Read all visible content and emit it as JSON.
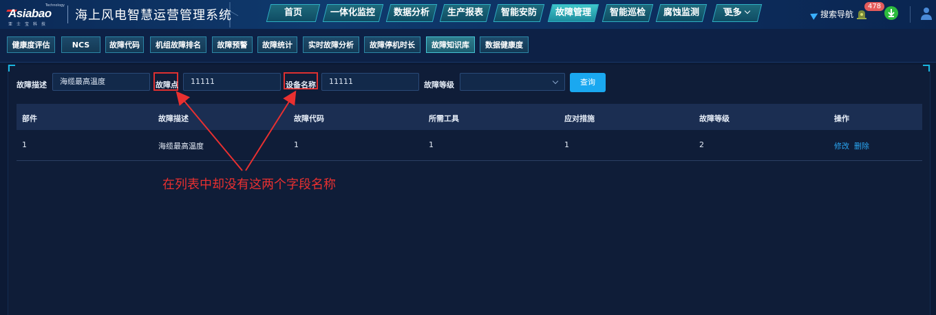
{
  "header": {
    "logo_text": "Asiabao",
    "logo_sub": "亚士宝科技",
    "logo_tech": "Technology",
    "system_title": "海上风电智慧运营管理系统",
    "nav": [
      {
        "label": "首页"
      },
      {
        "label": "一体化监控"
      },
      {
        "label": "数据分析"
      },
      {
        "label": "生产报表"
      },
      {
        "label": "智能安防"
      },
      {
        "label": "故障管理",
        "active": true
      },
      {
        "label": "智能巡检"
      },
      {
        "label": "腐蚀监测"
      },
      {
        "label": "更多"
      }
    ],
    "search_nav_label": "搜索导航",
    "notification_count": "478"
  },
  "subtabs": [
    {
      "label": "健康度评估"
    },
    {
      "label": "NCS"
    },
    {
      "label": "故障代码"
    },
    {
      "label": "机组故障排名"
    },
    {
      "label": "故障预警"
    },
    {
      "label": "故障统计"
    },
    {
      "label": "实时故障分析"
    },
    {
      "label": "故障停机时长"
    },
    {
      "label": "故障知识库",
      "active": true
    },
    {
      "label": "数据健康度"
    }
  ],
  "filters": {
    "fault_desc_label": "故障描述",
    "fault_desc_value": "海缆最高温度",
    "fault_point_label": "故障点",
    "fault_point_value": "11111",
    "device_name_label": "设备名称",
    "device_name_value": "11111",
    "fault_level_label": "故障等级",
    "fault_level_value": "",
    "query_label": "查询"
  },
  "table": {
    "columns": [
      "部件",
      "故障描述",
      "故障代码",
      "所需工具",
      "应对措施",
      "故障等级",
      "操作"
    ],
    "rows": [
      {
        "part": "1",
        "desc": "海缆最高温度",
        "code": "1",
        "tools": "1",
        "measures": "1",
        "level": "2",
        "edit": "修改",
        "delete": "删除"
      }
    ]
  },
  "annotation": {
    "text": "在列表中却没有这两个字段名称",
    "color": "#e93030"
  },
  "colors": {
    "accent": "#1aa8f0",
    "nav_active": "#3fc6c9",
    "highlight": "#e03030"
  }
}
